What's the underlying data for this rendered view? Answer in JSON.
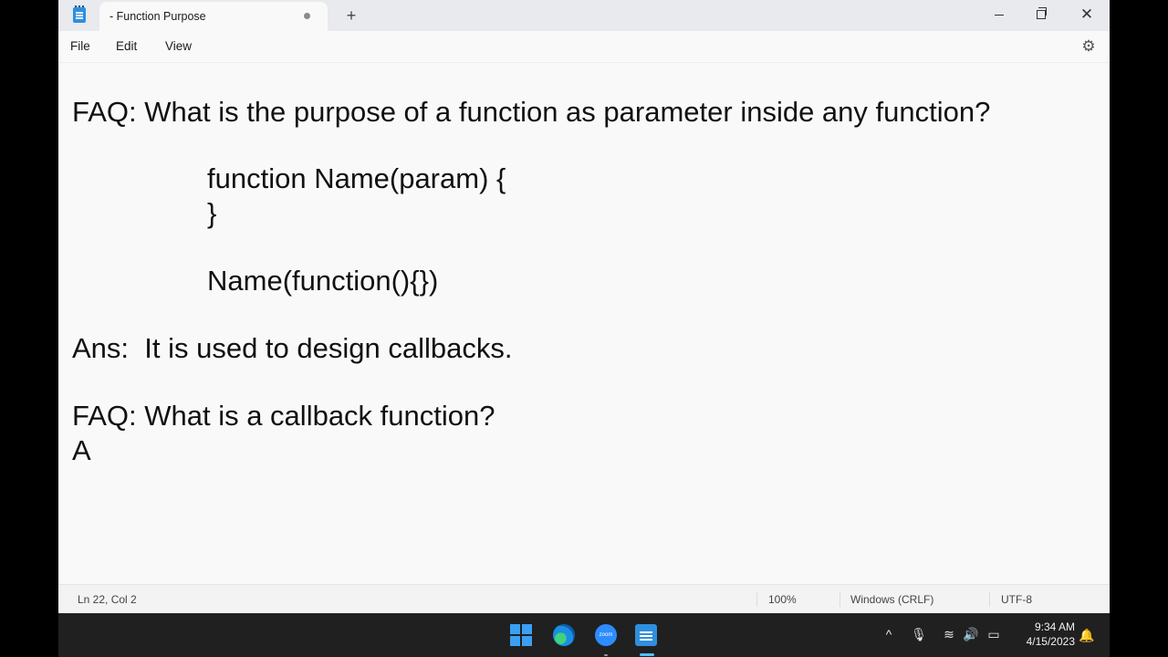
{
  "window": {
    "tab_title": "- Function Purpose",
    "new_tab_label": "+",
    "close_glyph": "✕"
  },
  "menu": {
    "file": "File",
    "edit": "Edit",
    "view": "View"
  },
  "editor": {
    "lines": [
      "FAQ: What is the purpose of a function as parameter inside any function?",
      "function Name(param) {",
      "}",
      "Name(function(){})",
      "Ans:  It is used to design callbacks.",
      "FAQ: What is a callback function?",
      "A"
    ]
  },
  "status": {
    "position": "Ln 22, Col 2",
    "zoom": "100%",
    "line_ending": "Windows (CRLF)",
    "encoding": "UTF-8"
  },
  "taskbar": {
    "zoom_label": "zoom",
    "time": "9:34 AM",
    "date": "4/15/2023"
  },
  "icons": {
    "app": "notepad-icon",
    "settings": "gear-icon",
    "start": "windows-start-icon",
    "edge": "edge-browser-icon",
    "zoom": "zoom-app-icon",
    "notepad": "notepad-taskbar-icon",
    "tray": [
      "chevron-up-icon",
      "microphone-icon",
      "wifi-icon",
      "volume-icon",
      "battery-icon",
      "notification-icon"
    ]
  },
  "colors": {
    "accent": "#2f8fde",
    "taskbar": "#202020",
    "active_indicator": "#4cc2ff"
  }
}
